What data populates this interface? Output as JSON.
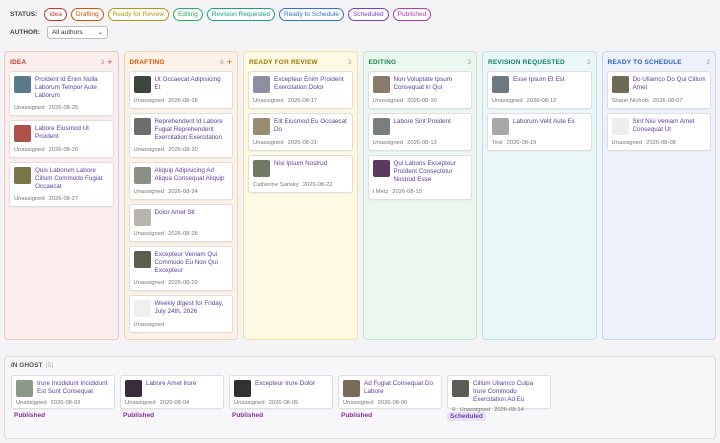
{
  "filters": {
    "status_label": "STATUS:",
    "statuses": [
      {
        "label": "Idea",
        "color": "#c0392b"
      },
      {
        "label": "Drafting",
        "color": "#d35400"
      },
      {
        "label": "Ready for Review",
        "color": "#b7950b"
      },
      {
        "label": "Editing",
        "color": "#27ae60"
      },
      {
        "label": "Revision Requested",
        "color": "#16a085"
      },
      {
        "label": "Ready to Schedule",
        "color": "#2e6fd8"
      },
      {
        "label": "Scheduled",
        "color": "#7d3cc8"
      },
      {
        "label": "Published",
        "color": "#b03ab0"
      }
    ],
    "author_label": "AUTHOR:",
    "author_value": "All authors"
  },
  "columns": [
    {
      "title": "IDEA",
      "count": "3",
      "plus": true,
      "title_color": "#c0392b",
      "bg": "#fdeeee",
      "border": "#f1c4c4",
      "cards": [
        {
          "title": "Proident Id Enim Nulla Laborum Tempor Aute Laborum",
          "author": "Unassigned",
          "date": "2026-08-25",
          "thumb": "#5a7a8c"
        },
        {
          "title": "Labore Eiusmod Ut Proident",
          "author": "Unassigned",
          "date": "2026-08-26",
          "thumb": "#b0514a"
        },
        {
          "title": "Quis Laborum Labore Cillum Commodo Fugiat Occaecat",
          "author": "Unassigned",
          "date": "2026-08-27",
          "thumb": "#7a7448"
        }
      ]
    },
    {
      "title": "DRAFTING",
      "count": "6",
      "plus": true,
      "title_color": "#d35400",
      "bg": "#fdf2e8",
      "border": "#f3d5b5",
      "cards": [
        {
          "title": "Ut Occaecat Adipisicing Et",
          "author": "Unassigned",
          "date": "2026-08-18",
          "thumb": "#3d4540"
        },
        {
          "title": "Reprehenderit Id Labore Fugiat Reprehenderit Exercitation Exercitation",
          "author": "Unassigned",
          "date": "2026-08-20",
          "thumb": "#6b6e6a"
        },
        {
          "title": "Aliquip Adipisicing Ad Aliqua Consequat Aliquip",
          "author": "Unassigned",
          "date": "2026-08-24",
          "thumb": "#8a8f88"
        },
        {
          "title": "Dolor Amet Sit",
          "author": "Unassigned",
          "date": "2026-08-28",
          "thumb": "#b9b4ab"
        },
        {
          "title": "Excepteur Veniam Qui Commodo Eu Non Qui Excepteur",
          "author": "Unassigned",
          "date": "2026-08-29",
          "thumb": "#5c5e4e"
        },
        {
          "title": "Weekly digest for Friday, July 24th, 2026",
          "author": "Unassigned",
          "date": "",
          "thumb": "#efefef"
        }
      ]
    },
    {
      "title": "READY FOR REVIEW",
      "count": "3",
      "plus": false,
      "title_color": "#9a7d0a",
      "bg": "#fdf9e3",
      "border": "#efe2a8",
      "cards": [
        {
          "title": "Excepteur Enim Proident Exercitation Dolor",
          "author": "Unassigned",
          "date": "2026-08-17",
          "thumb": "#8c8ea4"
        },
        {
          "title": "Elit Eiusmod Eu Occaecat Do",
          "author": "Unassigned",
          "date": "2026-08-21",
          "thumb": "#9a8c70"
        },
        {
          "title": "Nisi Ipsum Nostrud",
          "author": "Catherine Sarisky",
          "date": "2026-08-22",
          "thumb": "#6e7a62"
        }
      ]
    },
    {
      "title": "EDITING",
      "count": "3",
      "plus": false,
      "title_color": "#1e8449",
      "bg": "#ebf8ef",
      "border": "#bfe6cc",
      "cards": [
        {
          "title": "Non Voluptate Ipsum Consequat in Qui",
          "author": "Unassigned",
          "date": "2026-08-10",
          "thumb": "#8a7a6a"
        },
        {
          "title": "Labore Sint Proident",
          "author": "Unassigned",
          "date": "2026-08-13",
          "thumb": "#7a7e80"
        },
        {
          "title": "Qui Laboris Excepteur Proident Consectetur Nostrud Esse",
          "author": "I Metz",
          "date": "2026-08-15",
          "thumb": "#5a3a5e"
        }
      ]
    },
    {
      "title": "REVISION REQUESTED",
      "count": "2",
      "plus": false,
      "title_color": "#11806a",
      "bg": "#eaf7f8",
      "border": "#bde3e6",
      "cards": [
        {
          "title": "Esse Ipsum Et Est",
          "author": "Unassigned",
          "date": "2026-08-12",
          "thumb": "#6d7a82"
        },
        {
          "title": "Laborum Velit Aute Ex",
          "author": "Test",
          "date": "2026-08-19",
          "thumb": "#a5a9a8"
        }
      ]
    },
    {
      "title": "READY TO SCHEDULE",
      "count": "2",
      "plus": false,
      "title_color": "#2e5fc8",
      "bg": "#eef2fc",
      "border": "#c8d5f1",
      "cards": [
        {
          "title": "Do Ullamco Do Qui Cillum Amet",
          "author": "Shaun Nichols",
          "date": "2026-08-07",
          "thumb": "#6e6a55"
        },
        {
          "title": "Sint Nisi Veniam Amet Consequat Ut",
          "author": "Unassigned",
          "date": "2026-08-08",
          "thumb": "#eeeeee"
        }
      ]
    }
  ],
  "ghost": {
    "title": "IN GHOST",
    "count": "(5)",
    "items": [
      {
        "title": "Irure Incididunt Incididunt Est Sunt Consequat",
        "author": "Unassigned",
        "date": "2026-08-03",
        "status": "Published",
        "thumb": "#8a9a8a",
        "scheduled": false
      },
      {
        "title": "Labore Amet Irure",
        "author": "Unassigned",
        "date": "2026-08-04",
        "status": "Published",
        "thumb": "#3a2a3e",
        "scheduled": false
      },
      {
        "title": "Excepteur Irure Dolor",
        "author": "Unassigned",
        "date": "2026-08-05",
        "status": "Published",
        "thumb": "#2e3230",
        "scheduled": false
      },
      {
        "title": "Ad Fugiat Consequat Do Labore",
        "author": "Unassigned",
        "date": "2026-08-06",
        "status": "Published",
        "thumb": "#7a6a5a",
        "scheduled": false
      },
      {
        "title": "Cillum Ullamco Culpa Irure Commodo Exercitation Ad Eu",
        "author": "Unassigned",
        "date": "2026-08-14",
        "status": "Scheduled",
        "thumb": "#5a5e56",
        "scheduled": true
      }
    ]
  }
}
